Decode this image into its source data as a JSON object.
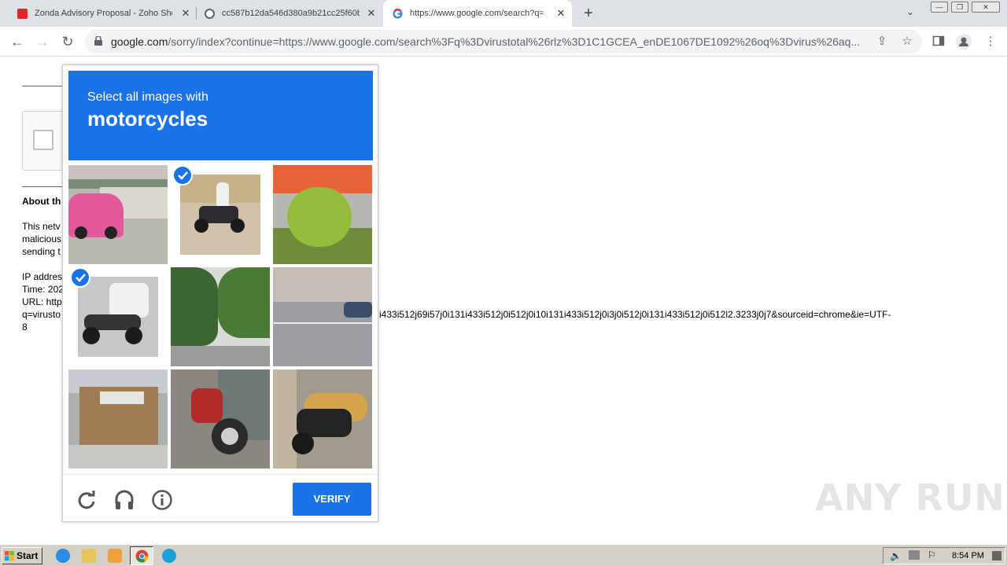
{
  "browser": {
    "tabs": [
      {
        "title": "Zonda Advisory Proposal - Zoho Sho",
        "favicon_color": "#e42527"
      },
      {
        "title": "cc587b12da546d380a9b21cc25f60b",
        "favicon_color": "#5f6368"
      },
      {
        "title": "https://www.google.com/search?q=",
        "favicon_color": "#4285f4"
      }
    ],
    "new_tab": "+",
    "tab_menu": "⌄",
    "window_buttons": {
      "minimize": "—",
      "restore": "❐",
      "close": "✕"
    },
    "url_host": "google.com",
    "url_rest": "/sorry/index?continue=https://www.google.com/search%3Fq%3Dvirustotal%26rlz%3D1C1GCEA_enDE1067DE1092%26oq%3Dvirus%26aq..."
  },
  "page": {
    "about_heading": "About th",
    "para_lines": [
      "This netv",
      "malicious",
      "sending t"
    ],
    "ip_lines": [
      "IP addres",
      "Time: 202",
      "URL: http",
      "q=virusto",
      "8"
    ],
    "url_overflow": "i433i512j69i57j0i131i433i512j0i512j0i10i131i433i512j0i3j0i512j0i131i433i512j0i512l2.3233j0j7&sourceid=chrome&ie=UTF-"
  },
  "captcha": {
    "line1": "Select all images with",
    "line2": "motorcycles",
    "tiles": [
      {
        "desc": "pink-car",
        "selected": false
      },
      {
        "desc": "motorcycle-rider",
        "selected": true
      },
      {
        "desc": "bush-and-car",
        "selected": false
      },
      {
        "desc": "motorcycle-and-car",
        "selected": true
      },
      {
        "desc": "trees-road",
        "selected": false
      },
      {
        "desc": "street",
        "selected": false
      },
      {
        "desc": "shop-building",
        "selected": false
      },
      {
        "desc": "red-scooter",
        "selected": false
      },
      {
        "desc": "yellow-scooter",
        "selected": false
      }
    ],
    "verify_label": "VERIFY"
  },
  "watermark": "ANY RUN",
  "taskbar": {
    "start_label": "Start",
    "clock": "8:54 PM"
  }
}
